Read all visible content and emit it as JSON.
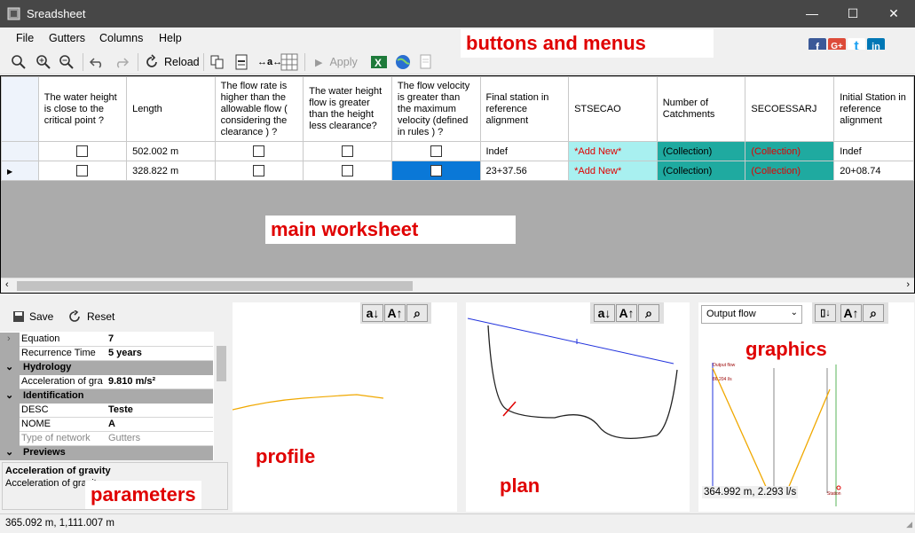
{
  "window": {
    "title": "Sreadsheet",
    "minimize": "—",
    "maximize": "☐",
    "close": "✕"
  },
  "menu": [
    "File",
    "Gutters",
    "Columns",
    "Help"
  ],
  "toolbar": {
    "reload": "Reload",
    "apply": "Apply"
  },
  "social": {
    "facebook": "f",
    "google": "G+",
    "twitter": "t",
    "linkedin": "in"
  },
  "labels": {
    "buttons": "buttons and menus",
    "worksheet": "main worksheet",
    "graphics": "graphics",
    "profile": "profile",
    "plan": "plan",
    "parameters": "parameters"
  },
  "grid": {
    "headers": [
      "The water height is close to the critical point ?",
      "Length",
      "The flow rate is higher than the allowable flow ( considering the clearance ) ?",
      "The water height flow is greater than the height less clearance?",
      "The flow velocity is greater than the maximum velocity (defined in rules ) ?",
      "Final station in reference alignment",
      "STSECAO",
      "Number of Catchments",
      "SECOESSARJ",
      "Initial Station in reference alignment"
    ],
    "rows": [
      {
        "length": "502.002 m",
        "final": "Indef",
        "stsecao": "*Add New*",
        "catch": "(Collection)",
        "seco": "(Collection)",
        "initial": "Indef"
      },
      {
        "length": "328.822 m",
        "final": "23+37.56",
        "stsecao": "*Add New*",
        "catch": "(Collection)",
        "seco": "(Collection)",
        "initial": "20+08.74"
      }
    ]
  },
  "params": {
    "save": "Save",
    "reset": "Reset",
    "rows": [
      {
        "type": "item",
        "expand": "›",
        "name": "Equation",
        "value": "7"
      },
      {
        "type": "item",
        "expand": "",
        "name": "Recurrence Time",
        "value": "5 years"
      },
      {
        "type": "cat",
        "expand": "⌄",
        "name": "Hydrology",
        "value": ""
      },
      {
        "type": "item",
        "expand": "",
        "name": "Acceleration of gra",
        "value": "9.810 m/s²"
      },
      {
        "type": "cat",
        "expand": "⌄",
        "name": "Identification",
        "value": ""
      },
      {
        "type": "item",
        "expand": "",
        "name": "DESC",
        "value": "Teste"
      },
      {
        "type": "item",
        "expand": "",
        "name": "NOME",
        "value": "A"
      },
      {
        "type": "item",
        "expand": "",
        "name": "Type of network",
        "value": "Gutters"
      },
      {
        "type": "cat",
        "expand": "⌄",
        "name": "Previews",
        "value": ""
      }
    ],
    "desc_title": "Acceleration of gravity",
    "desc_text": "Acceleration of gravity"
  },
  "graphics": {
    "select": "Output flow",
    "readout": "364.992 m, 2.293 l/s",
    "legend_title": "Output flow",
    "legend_value": "86.204 l/s",
    "station_label": "Station"
  },
  "status": "365.092 m, 1,111.007 m",
  "colors": {
    "titlebar": "#474747",
    "label": "#e00000",
    "selection": "#0a78d7",
    "teal": "#1faaa0",
    "addnew_bg": "#a8f0f0"
  }
}
